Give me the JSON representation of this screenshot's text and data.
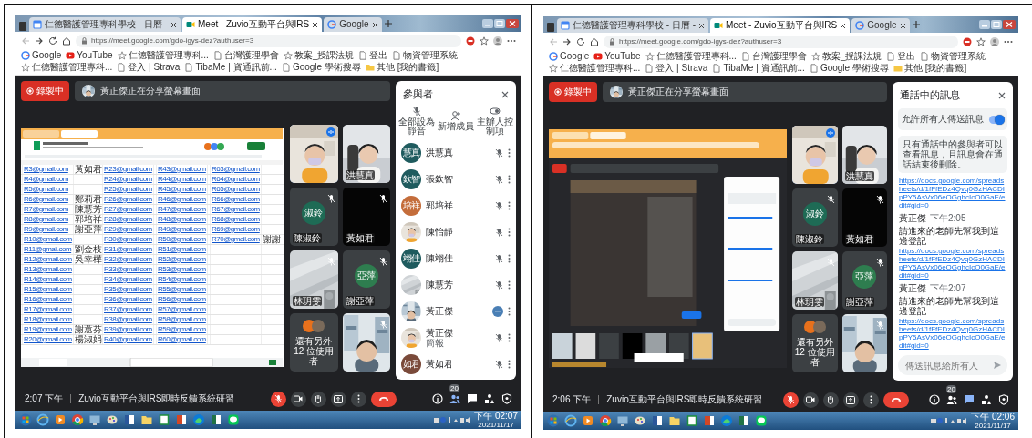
{
  "screenshots": [
    {
      "browser": {
        "tabs": [
          {
            "title": "仁德醫護管理專科學校 - 日曆 -",
            "kind": "calendar",
            "selected": false
          },
          {
            "title": "Meet - Zuvio互動平台與IRS",
            "kind": "meet",
            "selected": true
          },
          {
            "title": "Google",
            "kind": "google",
            "selected": false
          }
        ],
        "url": "https://meet.google.com/gdo-igys-dez?authuser=3",
        "bookmarks": [
          {
            "label": "Google",
            "kind": "google"
          },
          {
            "label": "YouTube",
            "kind": "youtube"
          },
          {
            "label": "仁德醫護管理專科...",
            "kind": "star"
          },
          {
            "label": "台灣護理學會",
            "kind": "page"
          },
          {
            "label": "教案_授課法規",
            "kind": "star"
          },
          {
            "label": "登出",
            "kind": "page"
          },
          {
            "label": "物資管理系統",
            "kind": "page"
          },
          {
            "label": "仁德醫護管理專科...",
            "kind": "star"
          },
          {
            "label": "登入 | Strava",
            "kind": "page"
          },
          {
            "label": "TibaMe | 資通訊前...",
            "kind": "page"
          },
          {
            "label": "Google 學術搜尋",
            "kind": "page"
          },
          {
            "label": "其他 [我的書籤]",
            "kind": "folder"
          }
        ]
      },
      "meet": {
        "recording": "錄製中",
        "banner": "黃正傑正在分享螢幕畫面",
        "shared": {
          "kind": "spreadsheet",
          "rows": [
            {
              "a": "R3@gmail.com",
              "b": "黃如君",
              "c": "R23@gmail.com",
              "e": "R43@gmail.com",
              "g": "R63@gmail.com"
            },
            {
              "a": "R4@gmail.com",
              "c": "R24@gmail.com",
              "e": "R44@gmail.com",
              "g": "R64@gmail.com"
            },
            {
              "a": "R5@gmail.com",
              "c": "R25@gmail.com",
              "e": "R45@gmail.com",
              "g": "R65@gmail.com"
            },
            {
              "a": "R6@gmail.com",
              "b": "鄭莉君",
              "c": "R26@gmail.com",
              "e": "R46@gmail.com",
              "g": "R66@gmail.com"
            },
            {
              "a": "R7@gmail.com",
              "b": "陳慧芳",
              "c": "R27@gmail.com",
              "e": "R47@gmail.com",
              "g": "R67@gmail.com"
            },
            {
              "a": "R8@gmail.com",
              "b": "郭培祥",
              "c": "R28@gmail.com",
              "e": "R48@gmail.com",
              "g": "R68@gmail.com"
            },
            {
              "a": "R9@gmail.com",
              "b": "謝亞萍",
              "c": "R29@gmail.com",
              "e": "R49@gmail.com",
              "g": "R69@gmail.com"
            },
            {
              "a": "R10@gmail.com",
              "c": "R30@gmail.com",
              "e": "R50@gmail.com",
              "g": "R70@gmail.com",
              "h": "謝謝"
            },
            {
              "a": "R11@gmail.com",
              "b": "劉金枝",
              "c": "R31@gmail.com",
              "e": "R51@gmail.com"
            },
            {
              "a": "R12@gmail.com",
              "b": "吳幸樺",
              "c": "R32@gmail.com",
              "e": "R52@gmail.com"
            },
            {
              "a": "R13@gmail.com",
              "c": "R33@gmail.com",
              "e": "R53@gmail.com"
            },
            {
              "a": "R14@gmail.com",
              "c": "R34@gmail.com",
              "e": "R54@gmail.com"
            },
            {
              "a": "R15@gmail.com",
              "c": "R35@gmail.com",
              "e": "R55@gmail.com"
            },
            {
              "a": "R16@gmail.com",
              "c": "R36@gmail.com",
              "e": "R56@gmail.com"
            },
            {
              "a": "R17@gmail.com",
              "c": "R37@gmail.com",
              "e": "R57@gmail.com"
            },
            {
              "a": "R18@gmail.com",
              "c": "R38@gmail.com",
              "e": "R58@gmail.com"
            },
            {
              "a": "R19@gmail.com",
              "b": "謝蕙芬",
              "c": "R39@gmail.com",
              "e": "R59@gmail.com"
            },
            {
              "a": "R20@gmail.com",
              "b": "楊淑娟",
              "c": "R40@gmail.com",
              "e": "R60@gmail.com"
            }
          ]
        },
        "tiles": [
          {
            "kind": "camera",
            "speaking": true,
            "muted": false
          },
          {
            "kind": "camera",
            "name": "洪慧真",
            "speaking": false,
            "muted": false
          },
          {
            "kind": "avatar",
            "initials": "淑鈴",
            "color": "#1e6b55",
            "name": "陳淑鈴",
            "speaking": false,
            "muted": true
          },
          {
            "kind": "off",
            "name": "黃如君",
            "speaking": false,
            "muted": true
          },
          {
            "kind": "camera",
            "name": "林玥雯",
            "speaking": false,
            "muted": true
          },
          {
            "kind": "avatar",
            "initials": "亞萍",
            "color": "#2e7d4f",
            "name": "謝亞萍",
            "speaking": false,
            "muted": true
          },
          {
            "kind": "others",
            "label": "還有另外 12 位使用者"
          },
          {
            "kind": "camera",
            "speaking": false,
            "muted": true
          }
        ],
        "panel": {
          "kind": "participants",
          "title": "參與者",
          "actions": [
            {
              "label": "全部設為靜音",
              "kind": "mute"
            },
            {
              "label": "新增成員",
              "kind": "add"
            },
            {
              "label": "主辦人控制項",
              "kind": "host"
            }
          ],
          "people": [
            {
              "name": "洪慧真",
              "kind": "initials",
              "initials": "慧真",
              "color": "#1f5b5e",
              "muted": true
            },
            {
              "name": "張欽智",
              "kind": "initials",
              "initials": "欽智",
              "color": "#1f5b5e",
              "muted": true
            },
            {
              "name": "郭培祥",
              "kind": "initials",
              "initials": "培祥",
              "color": "#c46d3b",
              "muted": true
            },
            {
              "name": "陳怡靜",
              "muted": true
            },
            {
              "name": "陳翊佳",
              "kind": "initials",
              "initials": "翊佳",
              "color": "#1f5b5e",
              "muted": true
            },
            {
              "name": "陳慧芳",
              "muted": true
            },
            {
              "name": "黃正傑",
              "muted": false
            },
            {
              "name": "黃正傑",
              "subtitle": "簡報",
              "muted": true
            },
            {
              "name": "黃如君",
              "kind": "initials",
              "initials": "如君",
              "color": "#7a4a3a",
              "muted": true
            }
          ]
        },
        "time": "2:07 下午",
        "title": "Zuvio互動平台與IRS即時反饋系統研習",
        "mic_muted": true,
        "people_count": "20",
        "side_icons": [
          {
            "kind": "info",
            "selected": false
          },
          {
            "kind": "people",
            "selected": true
          },
          {
            "kind": "chat",
            "selected": false
          },
          {
            "kind": "activities",
            "selected": false
          },
          {
            "kind": "safety",
            "selected": false
          }
        ]
      },
      "taskbar": {
        "clock_time": "下午 02:07",
        "clock_date": "2021/11/17"
      }
    },
    {
      "browser": {
        "tabs": [
          {
            "title": "仁德醫護管理專科學校 - 日曆 -",
            "kind": "calendar",
            "selected": false
          },
          {
            "title": "Meet - Zuvio互動平台與IRS",
            "kind": "meet",
            "selected": true
          },
          {
            "title": "Google",
            "kind": "google",
            "selected": false
          }
        ],
        "url": "https://meet.google.com/gdo-igys-dez?authuser=3",
        "bookmarks": [
          {
            "label": "Google",
            "kind": "google"
          },
          {
            "label": "YouTube",
            "kind": "youtube"
          },
          {
            "label": "仁德醫護管理專科...",
            "kind": "star"
          },
          {
            "label": "台灣護理學會",
            "kind": "page"
          },
          {
            "label": "教案_授課法規",
            "kind": "star"
          },
          {
            "label": "登出",
            "kind": "page"
          },
          {
            "label": "物資管理系統",
            "kind": "page"
          },
          {
            "label": "仁德醫護管理專科...",
            "kind": "star"
          },
          {
            "label": "登入 | Strava",
            "kind": "page"
          },
          {
            "label": "TibaMe | 資通訊前...",
            "kind": "page"
          },
          {
            "label": "Google 學術搜尋",
            "kind": "page"
          },
          {
            "label": "其他 [我的書籤]",
            "kind": "folder"
          }
        ]
      },
      "meet": {
        "recording": "錄製中",
        "banner": "黃正傑正在分享螢幕畫面",
        "shared": {
          "kind": "meet_view"
        },
        "tiles": [
          {
            "kind": "camera",
            "speaking": true,
            "muted": false
          },
          {
            "kind": "camera",
            "name": "洪慧真",
            "speaking": false,
            "muted": false
          },
          {
            "kind": "avatar",
            "initials": "淑鈴",
            "color": "#1e6b55",
            "name": "陳淑鈴",
            "speaking": false,
            "muted": true
          },
          {
            "kind": "off",
            "name": "黃如君",
            "speaking": false,
            "muted": true
          },
          {
            "kind": "camera",
            "name": "林玥雯",
            "speaking": false,
            "muted": true
          },
          {
            "kind": "avatar",
            "initials": "亞萍",
            "color": "#2e7d4f",
            "name": "謝亞萍",
            "speaking": false,
            "muted": true
          },
          {
            "kind": "others",
            "label": "還有另外 12 位使用者"
          },
          {
            "kind": "camera",
            "speaking": false,
            "muted": true
          }
        ],
        "panel": {
          "kind": "chat",
          "title": "通話中的訊息",
          "allow_label": "允許所有人傳送訊息",
          "allow_on": true,
          "notice": "只有通話中的參與者可以查看訊息，且訊息會在通話結束後刪除。",
          "messages": [
            {
              "link": "https://docs.google.com/spreadsheets/d/1fFfEDz4Qvq0GzHACDIpPY5AsVx06eOGghcIcO0GaE/edit#gid=0"
            },
            {
              "sender": "黃正傑",
              "time": "下午2:05",
              "text": "請進來的老師先幫我到這邊登記",
              "link": "https://docs.google.com/spreadsheets/d/1fFfEDz4Qvq0GzHACDIpPY5AsVx06eOGghcIcO0GaE/edit#gid=0"
            },
            {
              "sender": "黃正傑",
              "time": "下午2:07",
              "text": "請進來的老師先幫我到這邊登記",
              "link": "https://docs.google.com/spreadsheets/d/1fFfEDz4Qvq0GzHACDIpPY5AsVx06eOGghcIcO0GaE/edit#gid=0"
            }
          ],
          "placeholder": "傳送訊息給所有人"
        },
        "time": "2:06 下午",
        "title": "Zuvio互動平台與IRS即時反饋系統研習",
        "mic_muted": true,
        "people_count": "20",
        "side_icons": [
          {
            "kind": "info",
            "selected": false
          },
          {
            "kind": "people",
            "selected": false
          },
          {
            "kind": "chat",
            "selected": true
          },
          {
            "kind": "activities",
            "selected": false
          },
          {
            "kind": "safety",
            "selected": false
          }
        ]
      },
      "taskbar": {
        "clock_time": "下午 02:06",
        "clock_date": "2021/11/17"
      }
    }
  ]
}
